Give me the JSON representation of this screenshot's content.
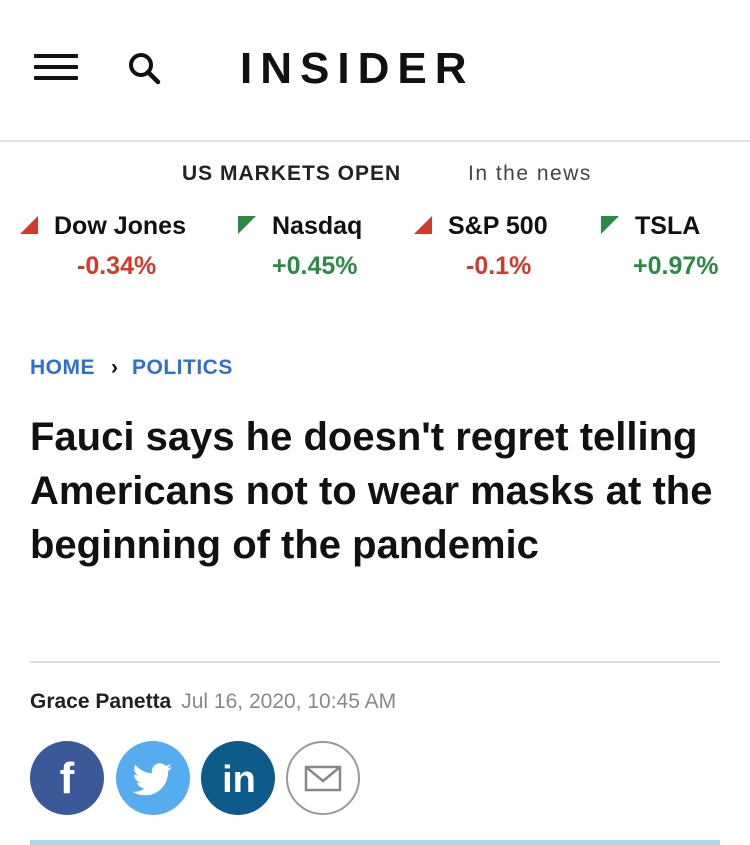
{
  "header": {
    "logo": "INSIDER",
    "menu_icon": "hamburger-menu-icon",
    "search_icon": "search-icon"
  },
  "markets": {
    "status": "US MARKETS OPEN",
    "news_link": "In the news",
    "tickers": [
      {
        "name": "Dow Jones",
        "change": "-0.34%",
        "direction": "down"
      },
      {
        "name": "Nasdaq",
        "change": "+0.45%",
        "direction": "up"
      },
      {
        "name": "S&P 500",
        "change": "-0.1%",
        "direction": "down"
      },
      {
        "name": "TSLA",
        "change": "+0.97%",
        "direction": "up"
      }
    ],
    "colors": {
      "down": "#d33a2c",
      "up": "#2d8a43"
    }
  },
  "breadcrumb": {
    "home": "HOME",
    "section": "POLITICS"
  },
  "article": {
    "title": "Fauci says he doesn't regret telling Americans not to wear masks at the beginning of the pandemic",
    "author": "Grace Panetta",
    "date": "Jul 16, 2020, 10:45 AM"
  },
  "share": {
    "facebook": "f",
    "linkedin": "in",
    "icons": [
      "facebook-icon",
      "twitter-icon",
      "linkedin-icon",
      "email-icon"
    ],
    "colors": {
      "facebook": "#3b5998",
      "twitter": "#55acee",
      "linkedin": "#0d5b8a"
    }
  }
}
